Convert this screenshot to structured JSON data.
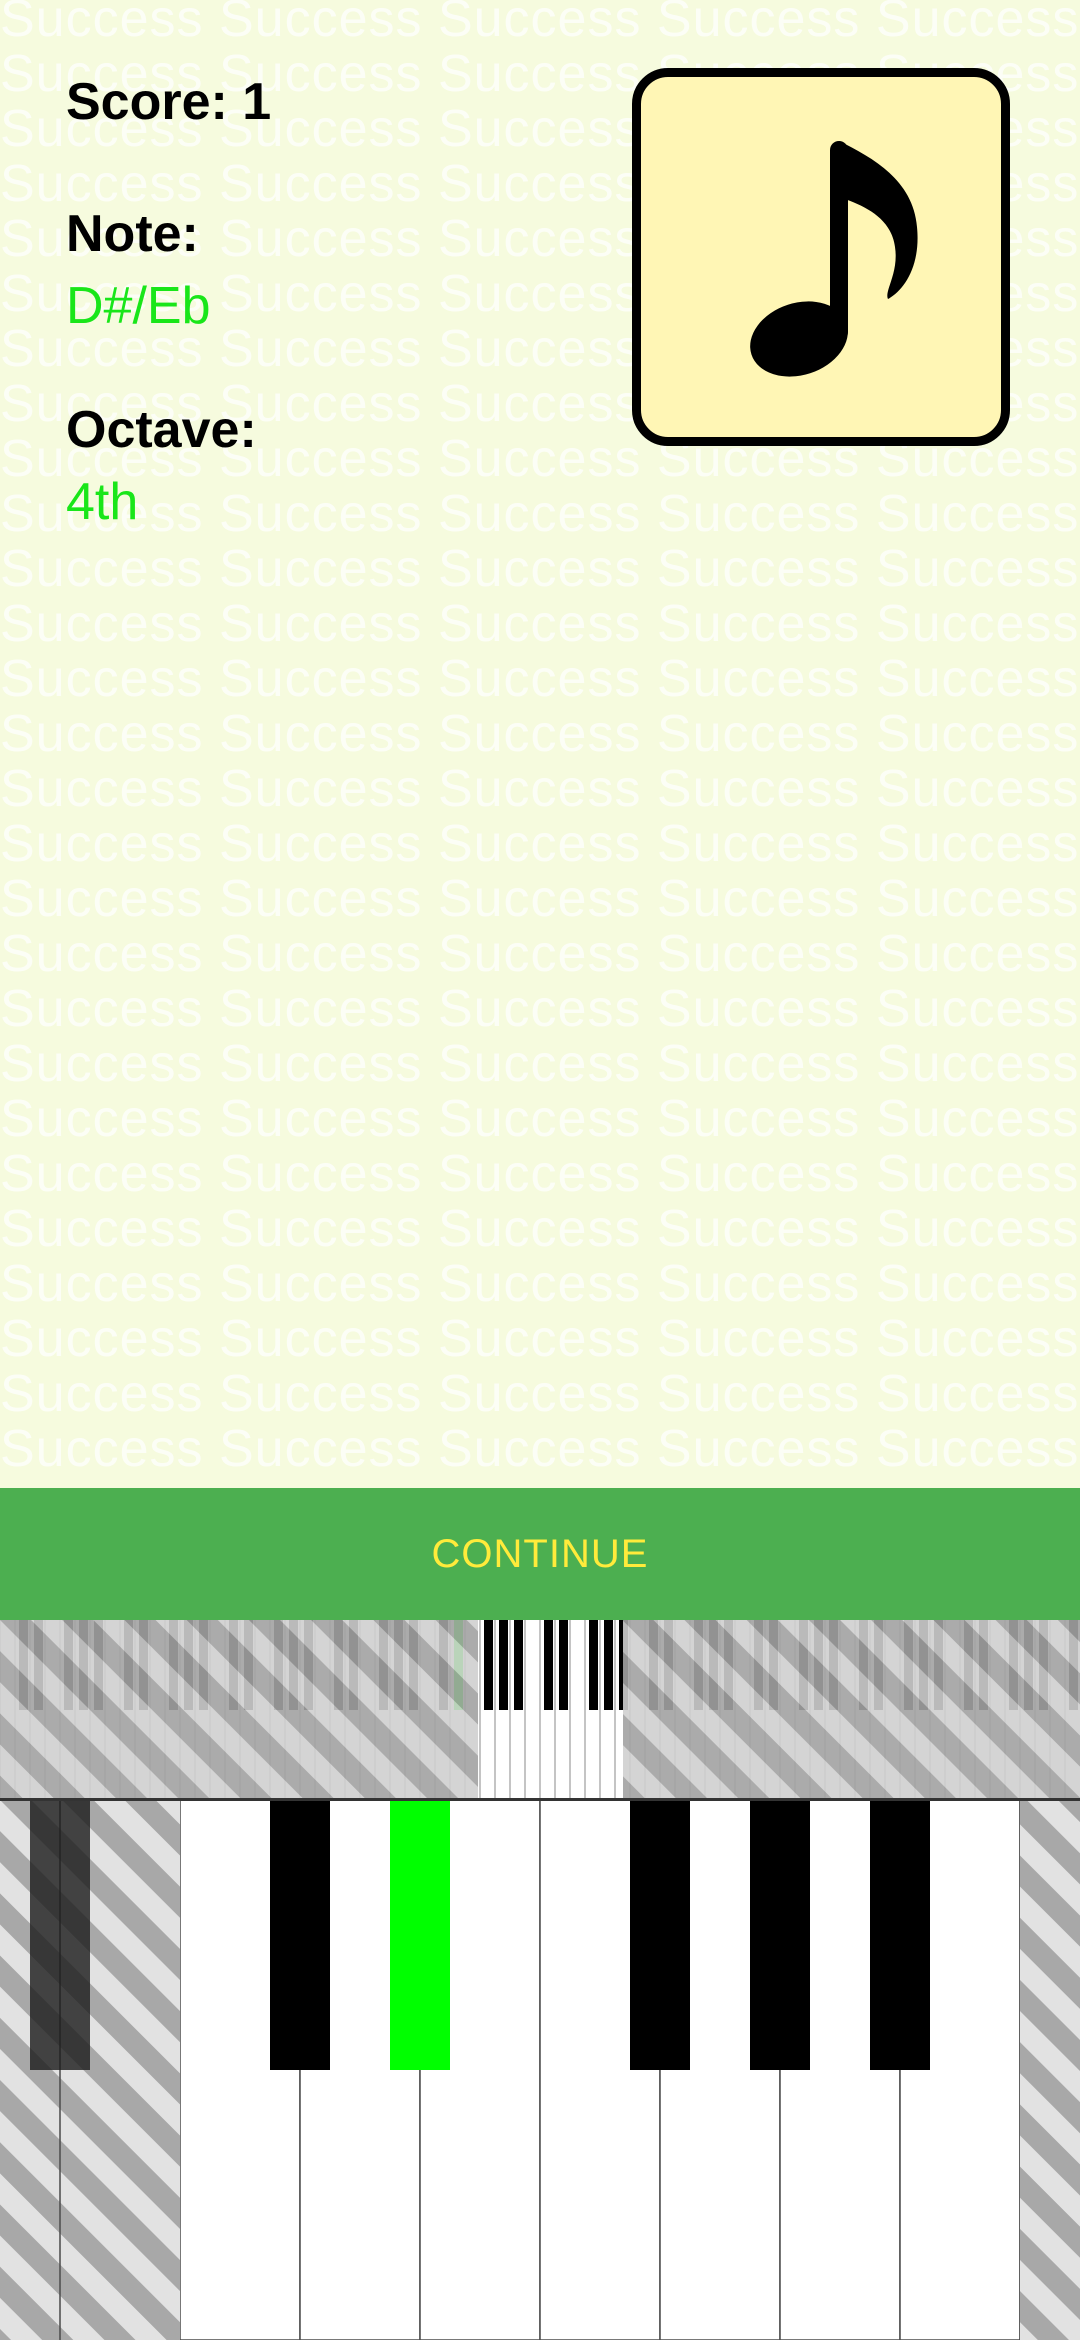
{
  "score": {
    "label": "Score: 1"
  },
  "note": {
    "label": "Note:",
    "value": "D#/Eb"
  },
  "octave": {
    "label": "Octave:",
    "value": "4th"
  },
  "watermark_text": "Success",
  "continue_label": "CONTINUE",
  "icons": {
    "note_card": "music-note-icon"
  },
  "colors": {
    "background": "#f6fbde",
    "accent_green": "#4caf50",
    "button_text": "#ffeb3b",
    "highlight_key": "#00ff00",
    "value_text": "#19e619",
    "card_fill": "#fff6b5"
  },
  "keyboard": {
    "highlighted_note": "D#/Eb",
    "disabled_overlay": "striped-gray"
  }
}
